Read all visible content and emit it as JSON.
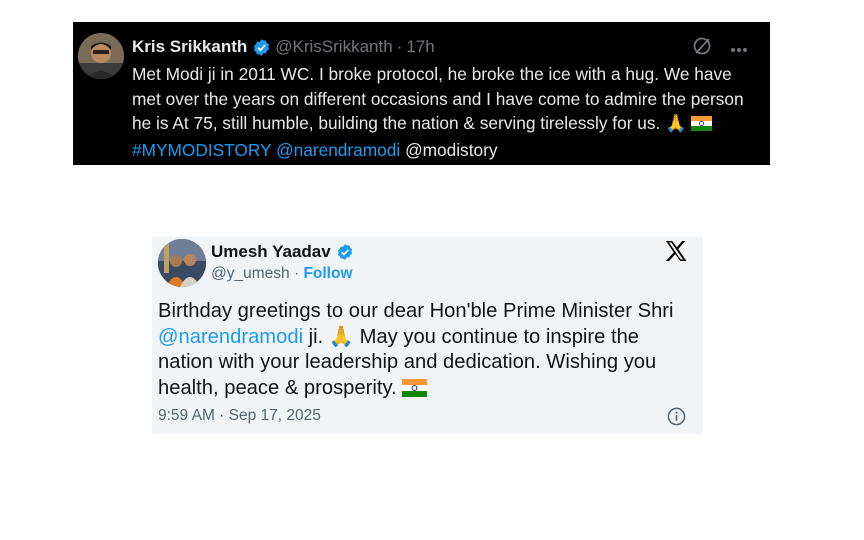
{
  "tweet1": {
    "name": "Kris Srikkanth",
    "handle": "@KrisSrikkanth",
    "separator": "·",
    "time": "17h",
    "text_part1": "Met Modi ji in 2011 WC. I broke protocol, he broke the ice with a hug. We have met over the years on different occasions and I have come to admire the person he is At 75, still humble, building the nation & serving tirelessly for us. ",
    "emoji_pray": "🙏",
    "hashtag": "#MYMODISTORY",
    "mention": "@narendramodi",
    "mention2": "@modistory",
    "colors": {
      "background": "#000000",
      "text": "#e7e9ea",
      "muted": "#71767b",
      "link": "#1d9bf0"
    },
    "icons": [
      "verified-badge-icon",
      "grok-icon",
      "more-icon",
      "india-flag-icon"
    ]
  },
  "tweet2": {
    "name": "Umesh Yaadav",
    "handle": "@y_umesh",
    "separator": "·",
    "follow_label": "Follow",
    "text_part1": "Birthday greetings to our dear Hon'ble Prime Minister Shri",
    "mention": "@narendramodi",
    "text_part2": " ji. ",
    "emoji_pray": "🙏",
    "text_part3": " May you continue to inspire the nation with your leadership and dedication. Wishing you health, peace & prosperity. ",
    "timestamp": "9:59 AM · Sep 17, 2025",
    "colors": {
      "background": "#f1f4f6",
      "text": "#0f1419",
      "muted": "#536471",
      "link": "#1d9bf0"
    },
    "icons": [
      "verified-badge-icon",
      "x-logo-icon",
      "info-icon",
      "india-flag-icon"
    ]
  }
}
